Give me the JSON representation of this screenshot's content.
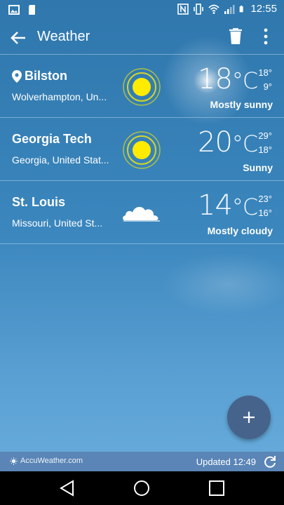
{
  "status_bar": {
    "time": "12:55"
  },
  "app_bar": {
    "title": "Weather"
  },
  "locations": [
    {
      "name": "Bilston",
      "subtitle": "Wolverhampton, Un...",
      "temp": "18",
      "unit": "°C",
      "high": "18°",
      "low": "9°",
      "condition": "Mostly sunny",
      "icon": "sun-icon",
      "current": true
    },
    {
      "name": "Georgia Tech",
      "subtitle": "Georgia, United Stat...",
      "temp": "20",
      "unit": "°C",
      "high": "29°",
      "low": "18°",
      "condition": "Sunny",
      "icon": "sun-icon"
    },
    {
      "name": "St. Louis",
      "subtitle": "Missouri, United St...",
      "temp": "14",
      "unit": "°C",
      "high": "23°",
      "low": "16°",
      "condition": "Mostly cloudy",
      "icon": "cloud-icon"
    }
  ],
  "footer": {
    "brand": "AccuWeather.com",
    "updated": "Updated 12:49"
  },
  "colors": {
    "sun": "#ffeb00",
    "fab": "#46638c",
    "footer": "#5a85b6"
  }
}
